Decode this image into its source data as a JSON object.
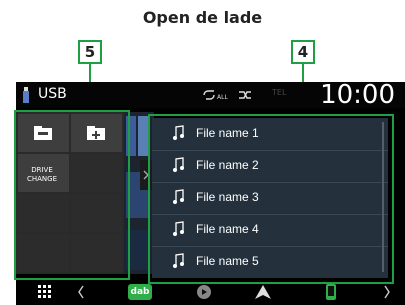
{
  "caption": "Open de lade",
  "callouts": {
    "left": "5",
    "right": "4"
  },
  "status_bar": {
    "source": "USB",
    "time": "10:00",
    "tel": "TEL"
  },
  "drawer": {
    "drive_change": "DRIVE CHANGE"
  },
  "file_list": [
    "File name 1",
    "File name 2",
    "File name 3",
    "File name 4",
    "File name 5"
  ],
  "dock": {
    "dab": "dab"
  },
  "colors": {
    "callout_green": "#1e9e45",
    "list_bg": "#24313c",
    "screen_bg": "#000000"
  }
}
